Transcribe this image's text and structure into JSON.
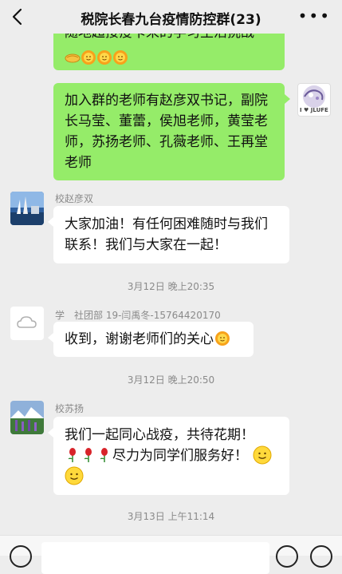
{
  "header": {
    "title": "税院长春九台疫情防控群(23)",
    "back_icon": "chevron-left-icon",
    "more_icon": "ellipsis-icon"
  },
  "messages": {
    "m1": {
      "text_partial": "随地超接疫卡来的学习生活挑战",
      "emojis": [
        "handshake-emoji",
        "sun-emoji",
        "sun-emoji",
        "sun-emoji"
      ]
    },
    "m2": {
      "text": "加入群的老师有赵彦双书记，副院长马莹、董蕾，侯旭老师，黄莹老师，苏扬老师、孔薇老师、王再堂老师",
      "avatar_caption": "I ♥ JLUFE"
    },
    "m3": {
      "sender": "校赵彦双",
      "text": "大家加油！有任何困难随时与我们联系！我们与大家在一起！"
    },
    "t1": "3月12日 晚上20:35",
    "m4": {
      "sender": "学　社团部 19-闫禹冬-15764420170",
      "text": "收到，谢谢老师们的关心"
    },
    "t2": "3月12日 晚上20:50",
    "m5": {
      "sender": "校苏扬",
      "text_a": "我们一起同心战疫，共待花期！",
      "text_b": "尽力为同学们服务好！"
    },
    "t3": "3月13日 上午11:14"
  },
  "colors": {
    "self_bubble": "#95ec69",
    "other_bubble": "#ffffff",
    "background": "#ededed"
  }
}
